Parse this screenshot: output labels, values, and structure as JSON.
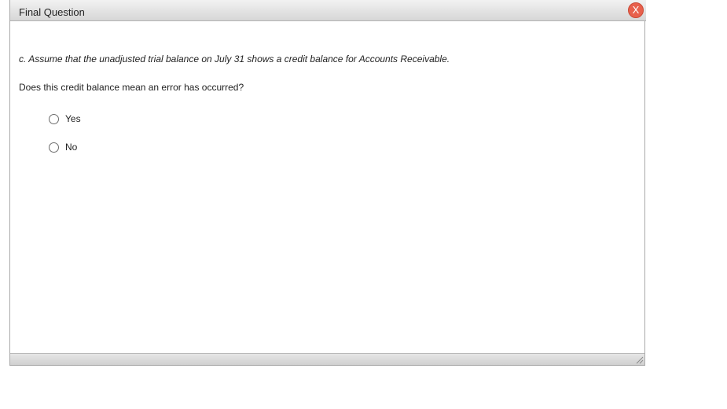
{
  "dialog": {
    "title": "Final Question",
    "close_label": "X"
  },
  "content": {
    "prompt": "c. Assume that the unadjusted trial balance on July 31 shows a credit balance for Accounts Receivable.",
    "question": "Does this credit balance mean an error has occurred?",
    "options": [
      {
        "label": "Yes",
        "selected": false
      },
      {
        "label": "No",
        "selected": false
      }
    ]
  },
  "colors": {
    "close_button": "#e8604c",
    "titlebar_top": "#f2f2f2",
    "titlebar_bottom": "#d6d6d6"
  },
  "icons": {
    "close": "close-icon",
    "resize": "resize-grip-icon"
  }
}
